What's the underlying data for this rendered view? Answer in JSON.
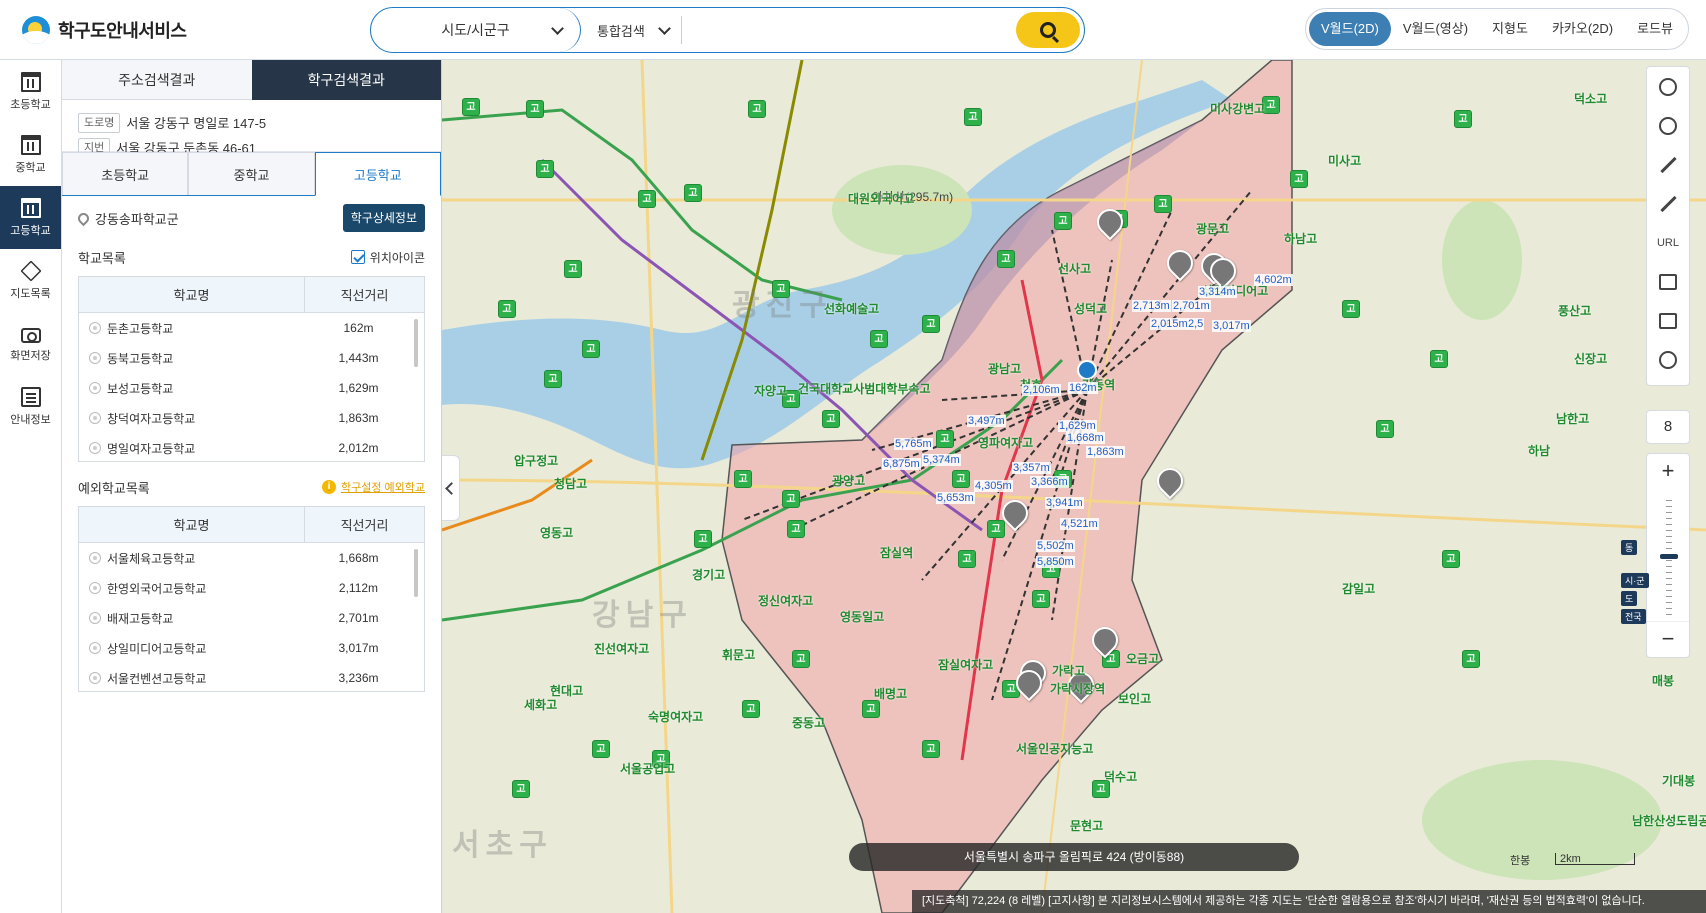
{
  "header": {
    "title": "학구도안내서비스",
    "region_select": "시도/시군구",
    "search_type": "통합검색",
    "search_placeholder": "",
    "map_tabs": [
      "V월드(2D)",
      "V월드(영상)",
      "지형도",
      "카카오(2D)",
      "로드뷰"
    ]
  },
  "left_nav": [
    {
      "label": "초등학교",
      "icon": "school-building-icon"
    },
    {
      "label": "중학교",
      "icon": "school-building-icon"
    },
    {
      "label": "고등학교",
      "icon": "school-building-icon",
      "active": true
    },
    {
      "label": "지도목록",
      "icon": "layers-icon"
    },
    {
      "label": "화면저장",
      "icon": "camera-icon"
    },
    {
      "label": "안내정보",
      "icon": "document-icon"
    }
  ],
  "panel": {
    "tabs": [
      "주소검색결과",
      "학구검색결과"
    ],
    "address": {
      "road_tag": "도로명",
      "road": "서울 강동구 명일로 147-5",
      "lot_tag": "지번",
      "lot": "서울 강동구 둔촌동 46-61"
    },
    "level_tabs": [
      "초등학교",
      "중학교",
      "고등학교"
    ],
    "district": "강동송파학교군",
    "detail_button": "학구상세정보",
    "school_list_title": "학교목록",
    "location_icon_label": "위치아이콘",
    "table_headers": [
      "학교명",
      "직선거리"
    ],
    "schools": [
      {
        "name": "둔촌고등학교",
        "distance": "162m"
      },
      {
        "name": "동북고등학교",
        "distance": "1,443m"
      },
      {
        "name": "보성고등학교",
        "distance": "1,629m"
      },
      {
        "name": "창덕여자고등학교",
        "distance": "1,863m"
      },
      {
        "name": "명일여자고등학교",
        "distance": "2,012m"
      }
    ],
    "exception_title": "예외학교목록",
    "exception_link": "학구설정 예외학교",
    "exceptions": [
      {
        "name": "서울체육고등학교",
        "distance": "1,668m"
      },
      {
        "name": "한영외국어고등학교",
        "distance": "2,112m"
      },
      {
        "name": "배재고등학교",
        "distance": "2,701m"
      },
      {
        "name": "상일미디어고등학교",
        "distance": "3,017m"
      },
      {
        "name": "서울컨벤션고등학교",
        "distance": "3,236m"
      }
    ]
  },
  "map": {
    "zoom_level": "8",
    "status_address": "서울특별시 송파구 올림픽로 424 (방이동88)",
    "scale_label": "한봉",
    "scale_value": "2km",
    "notice": "[지도축척] 72,224 (8 레벨) [고지사항] 본 지리정보시스템에서 제공하는 각종 지도는 '단순한 열람용으로 참조'하시기 바라며, '재산권 등의 법적효력'이 없습니다.",
    "tool_url_label": "URL",
    "zoom_levels": [
      "동",
      "시·군",
      "도",
      "전국"
    ],
    "district_names": [
      "광진구",
      "강남구",
      "서초구"
    ],
    "place_labels": [
      "아차산(295.7m)",
      "미사강변고",
      "하남고",
      "미사고",
      "감일고",
      "남한산성도립공원",
      "기대봉",
      "매봉",
      "하남",
      "덕소고",
      "남한고",
      "신장고",
      "풍산고",
      "잠실역",
      "천호",
      "강동역",
      "가락시장역",
      "서울인공지능고",
      "덕수고",
      "문현고",
      "잠실여자고",
      "영동일고",
      "정신여자고",
      "배명고",
      "보인고",
      "오금고",
      "가락고",
      "상일미디어고",
      "광문고",
      "선사고",
      "성덕고",
      "영파여자고",
      "광남고",
      "광양고",
      "자양고",
      "건국대학교사범대학부속고",
      "선화예술고",
      "대원외국어고",
      "경기고",
      "휘문고",
      "중동고",
      "숙명여자고",
      "세화고",
      "서울공업고",
      "현대고",
      "청담고",
      "압구정고",
      "영동고",
      "진선여자고"
    ],
    "distance_labels": [
      "162m",
      "1,668m",
      "1,863m",
      "1,629m",
      "2,106m",
      "3,497m",
      "2,713m",
      "2,701m",
      "3,314m",
      "4,602m",
      "2,015m",
      "2,5",
      "3,017m",
      "5,765m",
      "6,875m",
      "5,374m",
      "5,653m",
      "4,305m",
      "3,357m",
      "3,366m",
      "3,941m",
      "4,521m",
      "5,502m",
      "5,850m"
    ]
  },
  "colors": {
    "accent": "#1f7bc8",
    "nav_active": "#1d3a5a",
    "search_button": "#f5c518",
    "boundary_fill": "#f3a3a8",
    "marker_green": "#2eb14a"
  }
}
